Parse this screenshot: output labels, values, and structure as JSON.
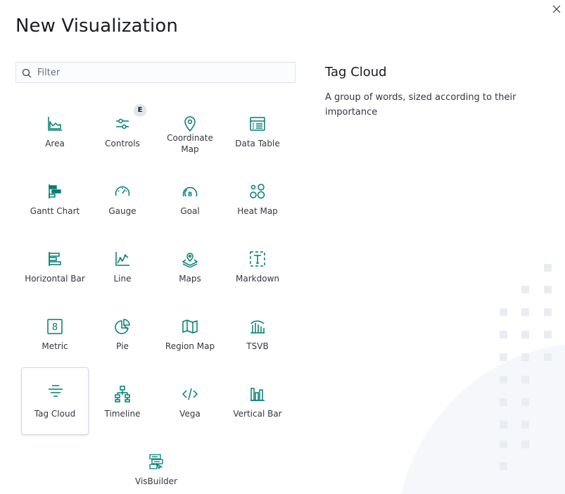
{
  "modal": {
    "title": "New Visualization",
    "close_icon": "close-icon"
  },
  "filter": {
    "placeholder": "Filter",
    "value": "",
    "icon": "search-icon"
  },
  "tiles": [
    {
      "label": "Area",
      "icon": "area-chart-icon"
    },
    {
      "label": "Controls",
      "icon": "controls-icon",
      "badge": "E"
    },
    {
      "label": "Coordinate Map",
      "icon": "map-pin-icon"
    },
    {
      "label": "Data Table",
      "icon": "table-icon"
    },
    {
      "label": "Gantt Chart",
      "icon": "gantt-chart-icon"
    },
    {
      "label": "Gauge",
      "icon": "gauge-icon"
    },
    {
      "label": "Goal",
      "icon": "goal-icon"
    },
    {
      "label": "Heat Map",
      "icon": "heatmap-icon"
    },
    {
      "label": "Horizontal Bar",
      "icon": "horizontal-bar-icon"
    },
    {
      "label": "Line",
      "icon": "line-chart-icon"
    },
    {
      "label": "Maps",
      "icon": "maps-icon"
    },
    {
      "label": "Markdown",
      "icon": "markdown-icon"
    },
    {
      "label": "Metric",
      "icon": "metric-icon"
    },
    {
      "label": "Pie",
      "icon": "pie-chart-icon"
    },
    {
      "label": "Region Map",
      "icon": "region-map-icon"
    },
    {
      "label": "TSVB",
      "icon": "tsvb-icon"
    },
    {
      "label": "Tag Cloud",
      "icon": "tag-cloud-icon",
      "selected": true
    },
    {
      "label": "Timeline",
      "icon": "timeline-icon"
    },
    {
      "label": "Vega",
      "icon": "code-icon"
    },
    {
      "label": "Vertical Bar",
      "icon": "vertical-bar-icon"
    },
    {
      "label": "VisBuilder",
      "icon": "visbuilder-icon"
    }
  ],
  "description": {
    "title": "Tag Cloud",
    "text": "A group of words, sized according to their importance"
  },
  "colors": {
    "icon": "#017d73",
    "text": "#343741",
    "title": "#1a1c21",
    "border": "#d3dae6",
    "decoration": "#f5f7fa",
    "badge": "#e0e5ee"
  }
}
